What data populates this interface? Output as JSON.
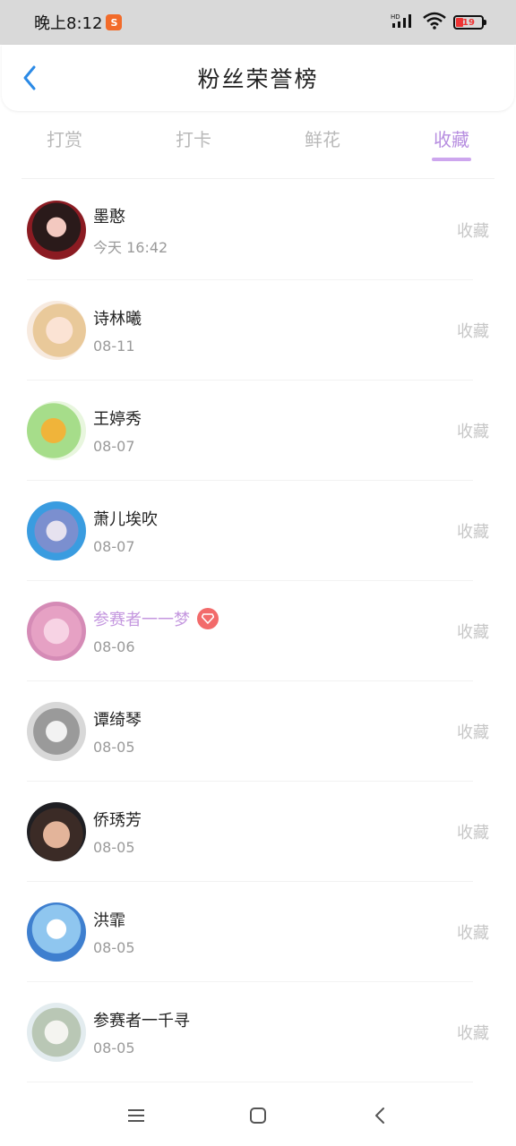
{
  "status_bar": {
    "time": "晚上8:12",
    "app_badge_icon": "kuaishou-icon",
    "network_label": "HD",
    "battery_level": "19",
    "battery_color": "#e33333"
  },
  "header": {
    "title": "粉丝荣誉榜",
    "back_icon": "chevron-left-icon",
    "accent_color": "#2b8ae6"
  },
  "tabs": [
    {
      "label": "打赏",
      "active": false
    },
    {
      "label": "打卡",
      "active": false
    },
    {
      "label": "鲜花",
      "active": false
    },
    {
      "label": "收藏",
      "active": true
    }
  ],
  "active_tab_color": "#b78ee0",
  "fans": [
    {
      "name": "墨憨",
      "date": "今天 16:42",
      "action": "收藏",
      "vip": false
    },
    {
      "name": "诗林曦",
      "date": "08-11",
      "action": "收藏",
      "vip": false
    },
    {
      "name": "王婷秀",
      "date": "08-07",
      "action": "收藏",
      "vip": false
    },
    {
      "name": "萧儿埃吹",
      "date": "08-07",
      "action": "收藏",
      "vip": false
    },
    {
      "name": "参赛者一一梦",
      "date": "08-06",
      "action": "收藏",
      "vip": true
    },
    {
      "name": "谭绮琴",
      "date": "08-05",
      "action": "收藏",
      "vip": false
    },
    {
      "name": "侨琇芳",
      "date": "08-05",
      "action": "收藏",
      "vip": false
    },
    {
      "name": "洪霏",
      "date": "08-05",
      "action": "收藏",
      "vip": false
    },
    {
      "name": "参赛者一千寻",
      "date": "08-05",
      "action": "收藏",
      "vip": false
    }
  ],
  "nav_bar": {
    "icons": [
      "menu-icon",
      "home-square-icon",
      "back-triangle-icon"
    ]
  }
}
